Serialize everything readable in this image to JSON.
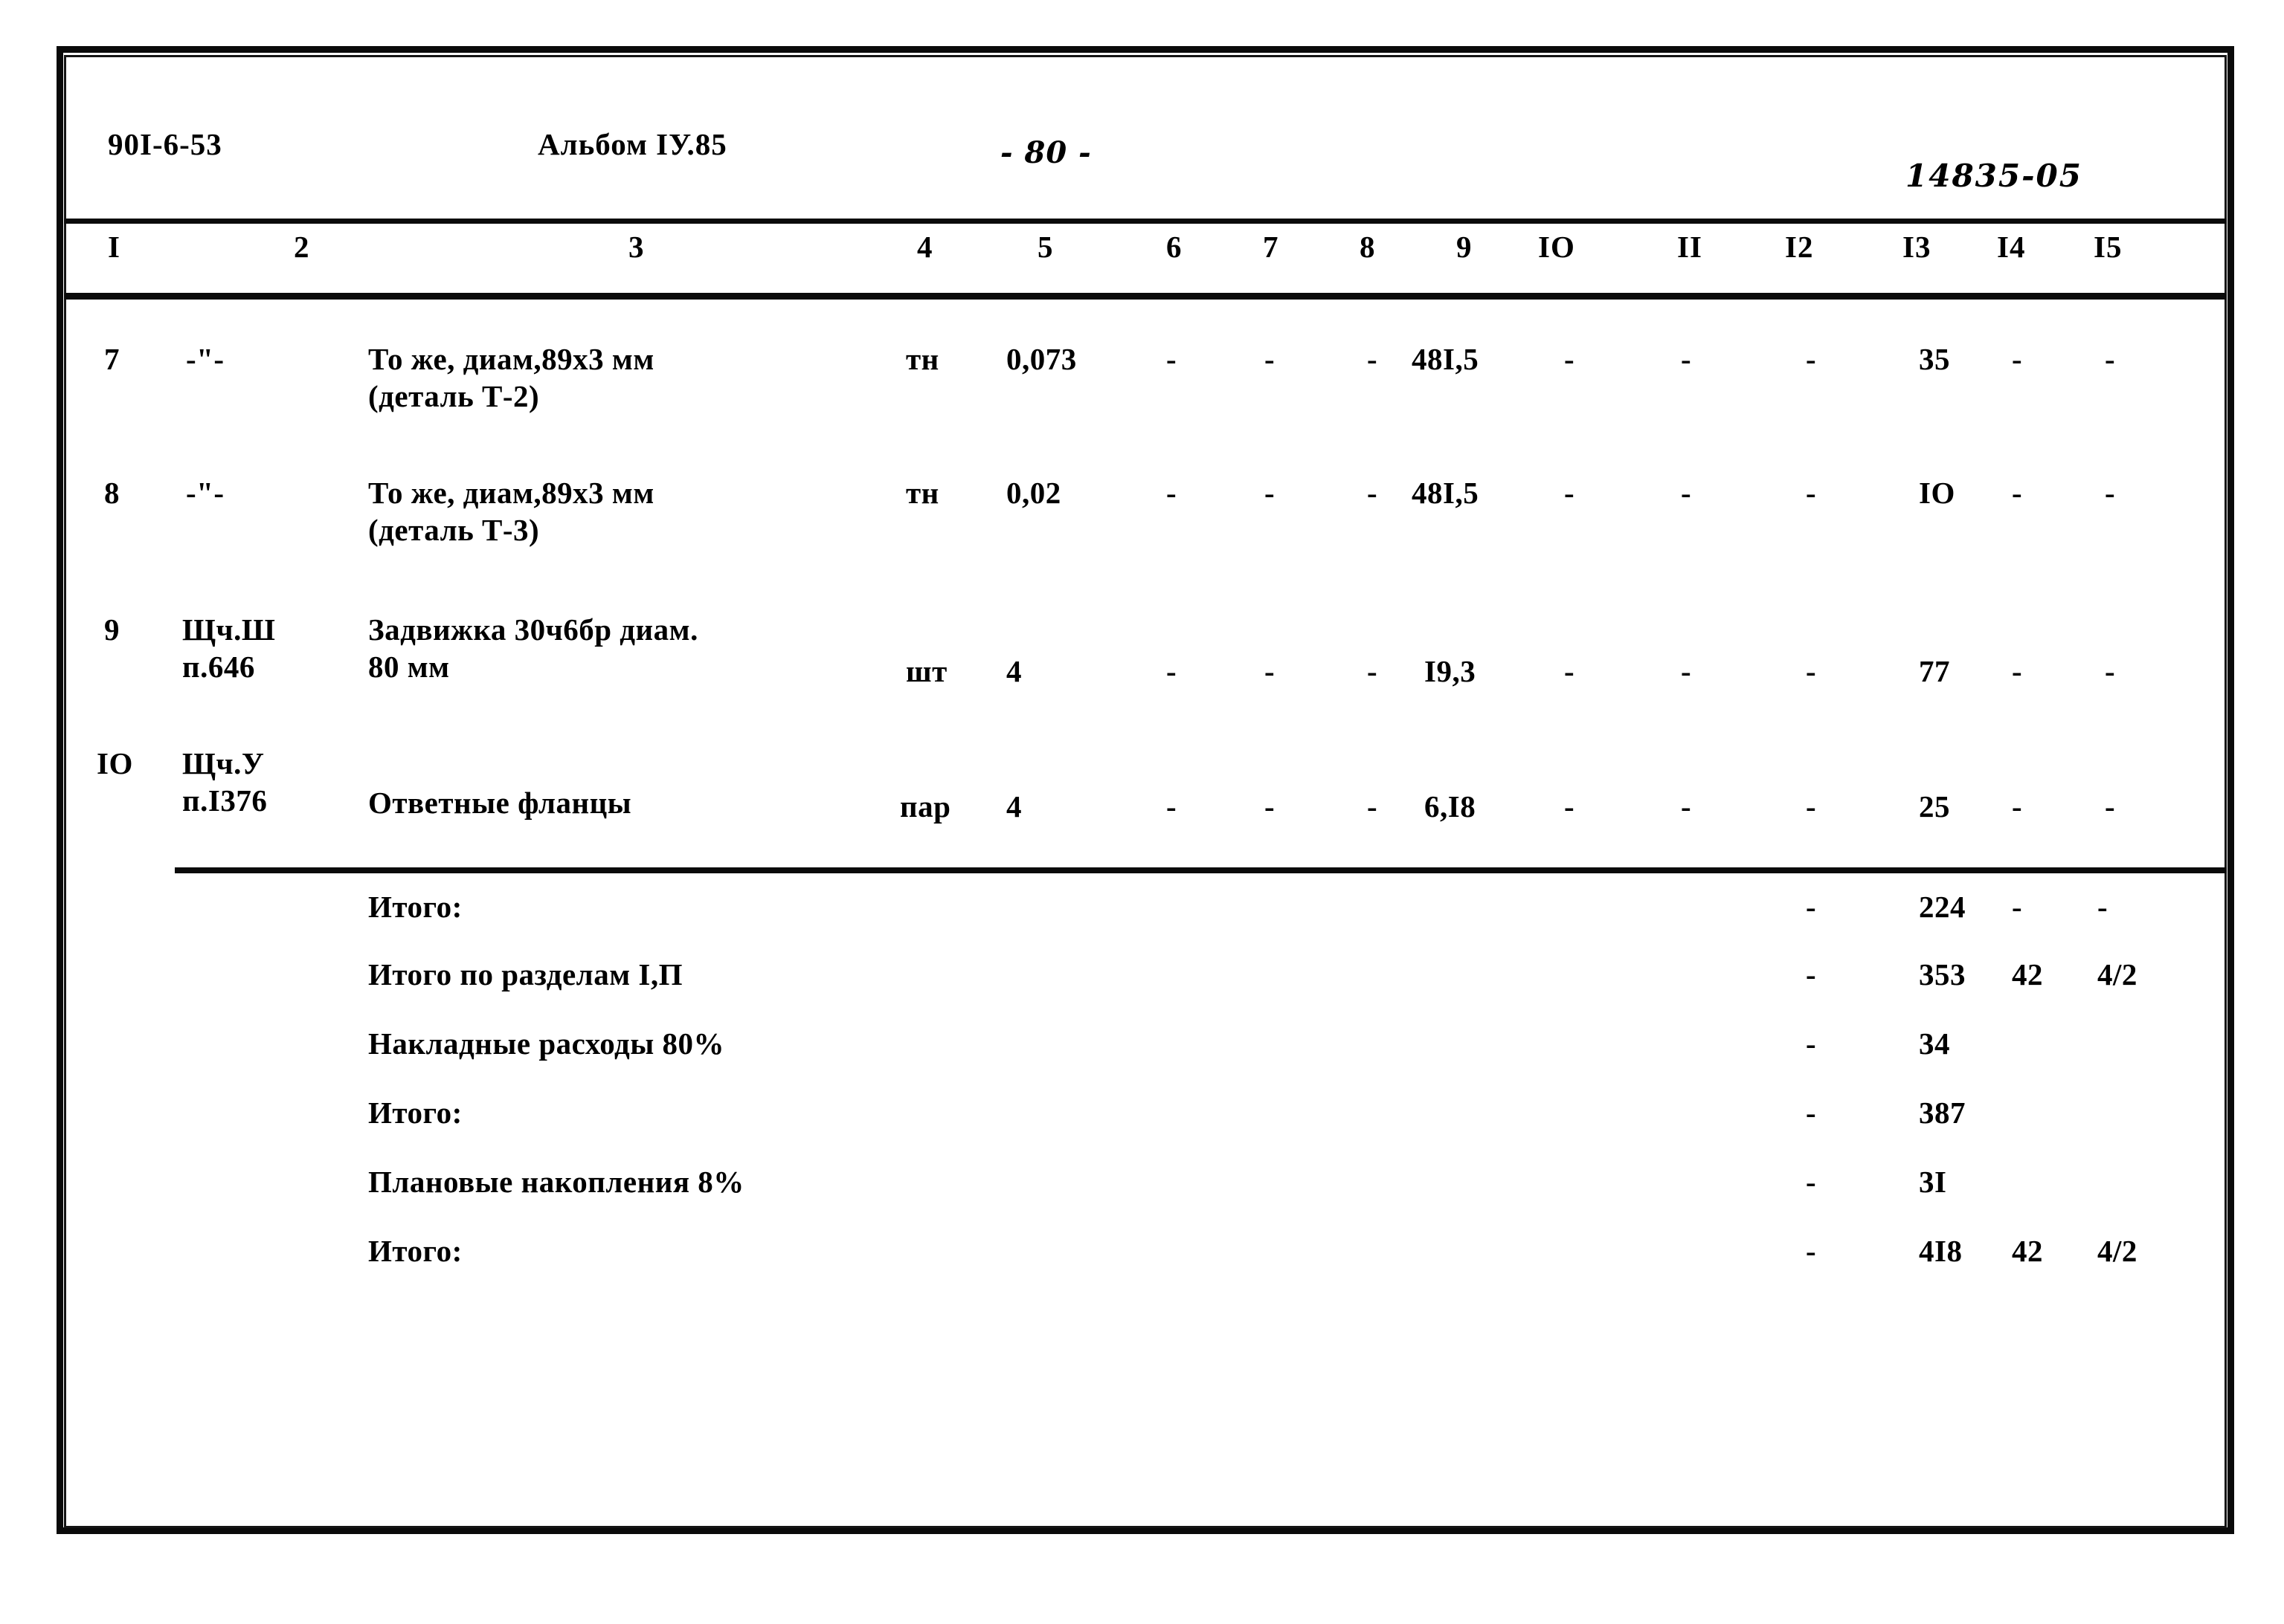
{
  "header": {
    "doc_code": "90I-6-53",
    "album": "Альбом IУ.85",
    "page_number": "- 80 -",
    "stamp": "14835-05"
  },
  "table": {
    "column_headers": [
      "I",
      "2",
      "3",
      "4",
      "5",
      "6",
      "7",
      "8",
      "9",
      "IO",
      "II",
      "I2",
      "I3",
      "I4",
      "I5"
    ],
    "rows": [
      {
        "c1": "7",
        "c2": "-\"-",
        "c3_line1": "То же, диам,89х3 мм",
        "c3_line2": "(деталь Т-2)",
        "c4": "тн",
        "c5": "0,073",
        "c6": "-",
        "c7": "-",
        "c8": "-",
        "c9": "48I,5",
        "c10": "-",
        "c11": "-",
        "c12": "-",
        "c13": "35",
        "c14": "-",
        "c15": "-"
      },
      {
        "c1": "8",
        "c2": "-\"-",
        "c3_line1": "То же, диам,89х3 мм",
        "c3_line2": "(деталь Т-3)",
        "c4": "тн",
        "c5": "0,02",
        "c6": "-",
        "c7": "-",
        "c8": "-",
        "c9": "48I,5",
        "c10": "-",
        "c11": "-",
        "c12": "-",
        "c13": "IO",
        "c14": "-",
        "c15": "-"
      },
      {
        "c1": "9",
        "c2_line1": "Щч.Ш",
        "c2_line2": "п.646",
        "c3_line1": "Задвижка 30ч6бр диам.",
        "c3_line2": "80 мм",
        "c4": "шт",
        "c5": "4",
        "c6": "-",
        "c7": "-",
        "c8": "-",
        "c9": "I9,3",
        "c10": "-",
        "c11": "-",
        "c12": "-",
        "c13": "77",
        "c14": "-",
        "c15": "-"
      },
      {
        "c1": "IO",
        "c2_line1": "Щч.У",
        "c2_line2": "п.I376",
        "c3_line1": "Ответные фланцы",
        "c3_line2": "",
        "c4": "пар",
        "c5": "4",
        "c6": "-",
        "c7": "-",
        "c8": "-",
        "c9": "6,I8",
        "c10": "-",
        "c11": "-",
        "c12": "-",
        "c13": "25",
        "c14": "-",
        "c15": "-"
      }
    ]
  },
  "summary": {
    "rows": [
      {
        "label": "Итого:",
        "c12": "-",
        "c13": "224",
        "c14": "-",
        "c15": "-"
      },
      {
        "label": "Итого по разделам I,П",
        "c12": "-",
        "c13": "353",
        "c14": "42",
        "c15": "4/2"
      },
      {
        "label": "Накладные расходы 80%",
        "c12": "-",
        "c13": "34",
        "c14": "",
        "c15": ""
      },
      {
        "label": "Итого:",
        "c12": "-",
        "c13": "387",
        "c14": "",
        "c15": ""
      },
      {
        "label": "Плановые накопления 8%",
        "c12": "-",
        "c13": "3I",
        "c14": "",
        "c15": ""
      },
      {
        "label": "Итого:",
        "c12": "-",
        "c13": "4I8",
        "c14": "42",
        "c15": "4/2"
      }
    ]
  }
}
